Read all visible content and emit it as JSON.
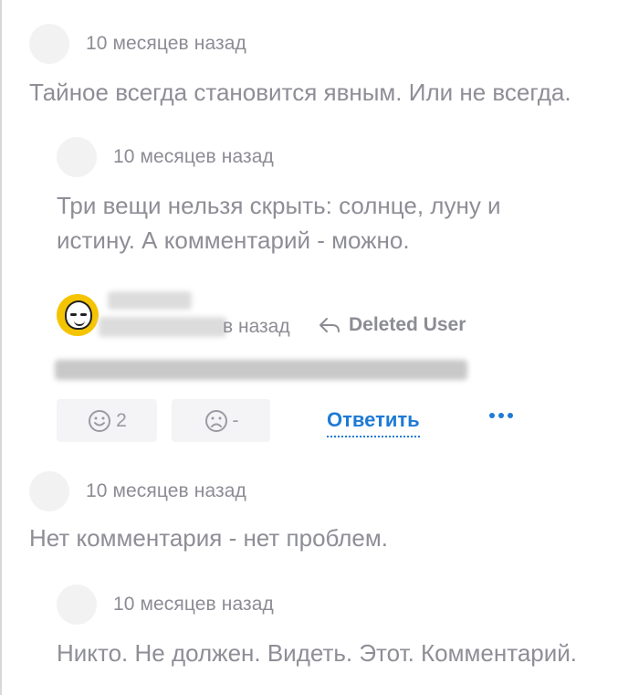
{
  "comments": [
    {
      "time": "10 месяцев назад",
      "text": "Тайное всегда становится явным. Или не всегда."
    },
    {
      "time": "10 месяцев назад",
      "text": "Три вещи нельзя скрыть: солнце, луну и истину. А комментарий - можно."
    },
    {
      "time": "10 месяцев назад",
      "text": "Нет комментария - нет проблем."
    },
    {
      "time": "10 месяцев назад",
      "text": "Никто. Не должен. Видеть. Этот. Комментарий."
    }
  ],
  "highlight": {
    "time_partial": "в назад",
    "reply_to": "Deleted User",
    "like_count": "2",
    "dislike_count": "-",
    "reply_label": "Ответить"
  },
  "colors": {
    "accent": "#1e7ad6",
    "muted_text": "#8e8e96",
    "avatar_yellow": "#f5c400"
  },
  "icons": [
    "smile-icon",
    "frown-icon",
    "reply-arrow-icon",
    "more-dots-icon"
  ]
}
